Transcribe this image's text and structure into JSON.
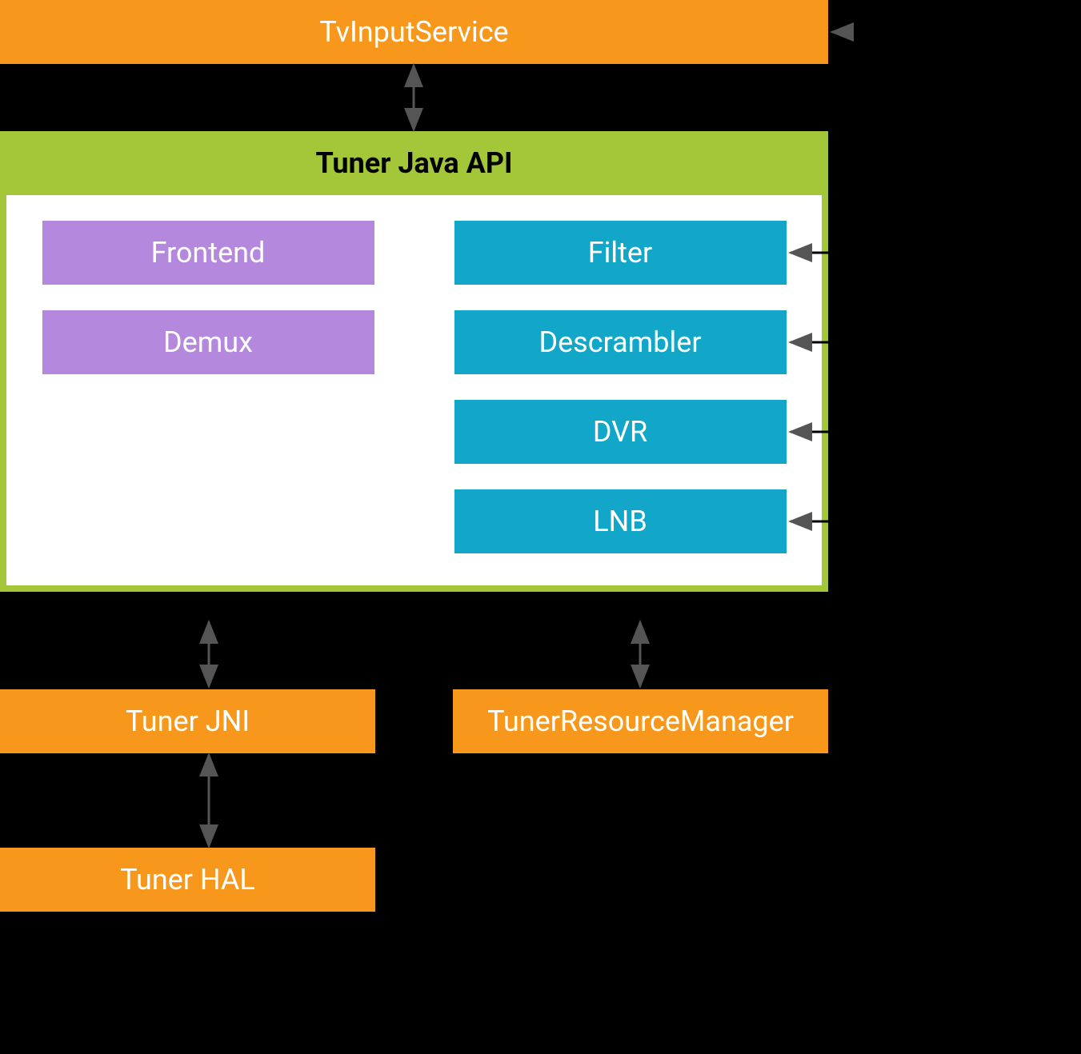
{
  "diagram": {
    "tv_input_service": "TvInputService",
    "tuner_java_api": "Tuner Java API",
    "left_items": {
      "frontend": "Frontend",
      "demux": "Demux"
    },
    "right_items": {
      "filter": "Filter",
      "descrambler": "Descrambler",
      "dvr": "DVR",
      "lnb": "LNB"
    },
    "tuner_jni": "Tuner JNI",
    "tuner_resource_manager": "TunerResourceManager",
    "tuner_hal": "Tuner HAL"
  },
  "colors": {
    "orange": "#f7981d",
    "green": "#a4c639",
    "purple": "#b388dd",
    "blue": "#12a7c8",
    "background": "#000000",
    "arrow": "#555555"
  }
}
